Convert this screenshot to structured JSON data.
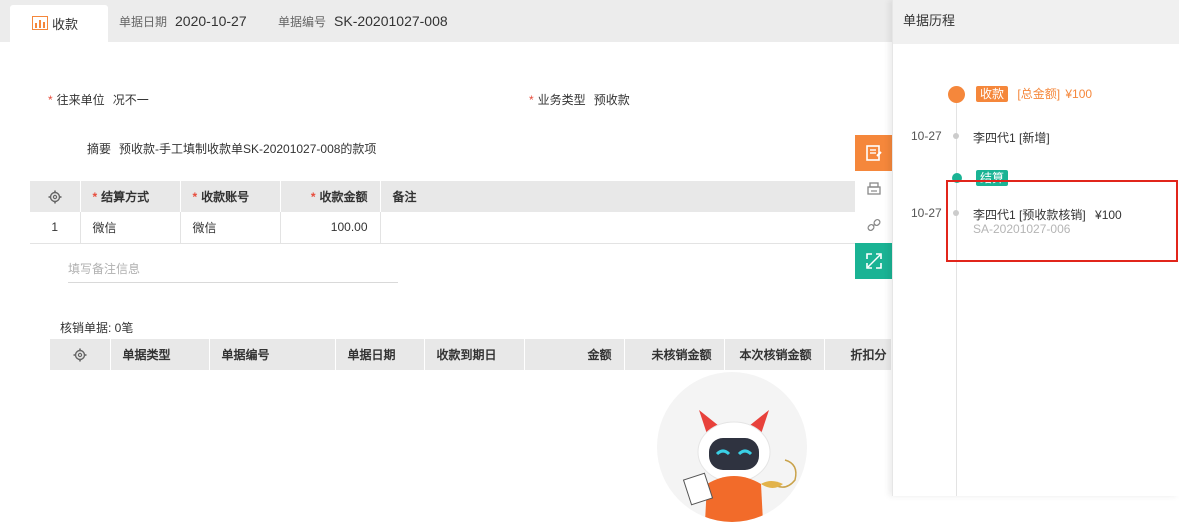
{
  "tab": {
    "label": "收款",
    "icon": "chart-icon"
  },
  "meta": {
    "date_label": "单据日期",
    "date_value": "2020-10-27",
    "number_label": "单据编号",
    "number_value": "SK-20201027-008"
  },
  "form": {
    "partner_label": "往来单位",
    "partner_value": "况不一",
    "biztype_label": "业务类型",
    "biztype_value": "预收款",
    "summary_label": "摘要",
    "summary_value": "预收款-手工填制收款单SK-20201027-008的款项",
    "required_mark": "*"
  },
  "payment_table": {
    "headers": [
      "结算方式",
      "收款账号",
      "收款金额",
      "备注"
    ],
    "rows": [
      {
        "index": "1",
        "method": "微信",
        "account": "微信",
        "amount": "100.00",
        "remark": ""
      }
    ]
  },
  "remark_placeholder": "填写备注信息",
  "verify": {
    "label": "核销单据: 0笔",
    "headers": [
      "单据类型",
      "单据编号",
      "单据日期",
      "收款到期日",
      "金额",
      "未核销金额",
      "本次核销金额",
      "折扣分"
    ]
  },
  "history": {
    "title": "单据历程",
    "event1": {
      "badge": "收款",
      "total_label": "[总金额]",
      "total_value": "¥100"
    },
    "event2": {
      "date": "10-27",
      "text": "李四代1 [新增]"
    },
    "event3_badge": "结算",
    "event4": {
      "date": "10-27",
      "text": "李四代1 [预收款核销]",
      "amount": "¥100",
      "ref": "SA-20201027-006"
    }
  },
  "colors": {
    "orange": "#f5873b",
    "teal": "#1ab394",
    "highlight": "#e1251b"
  }
}
